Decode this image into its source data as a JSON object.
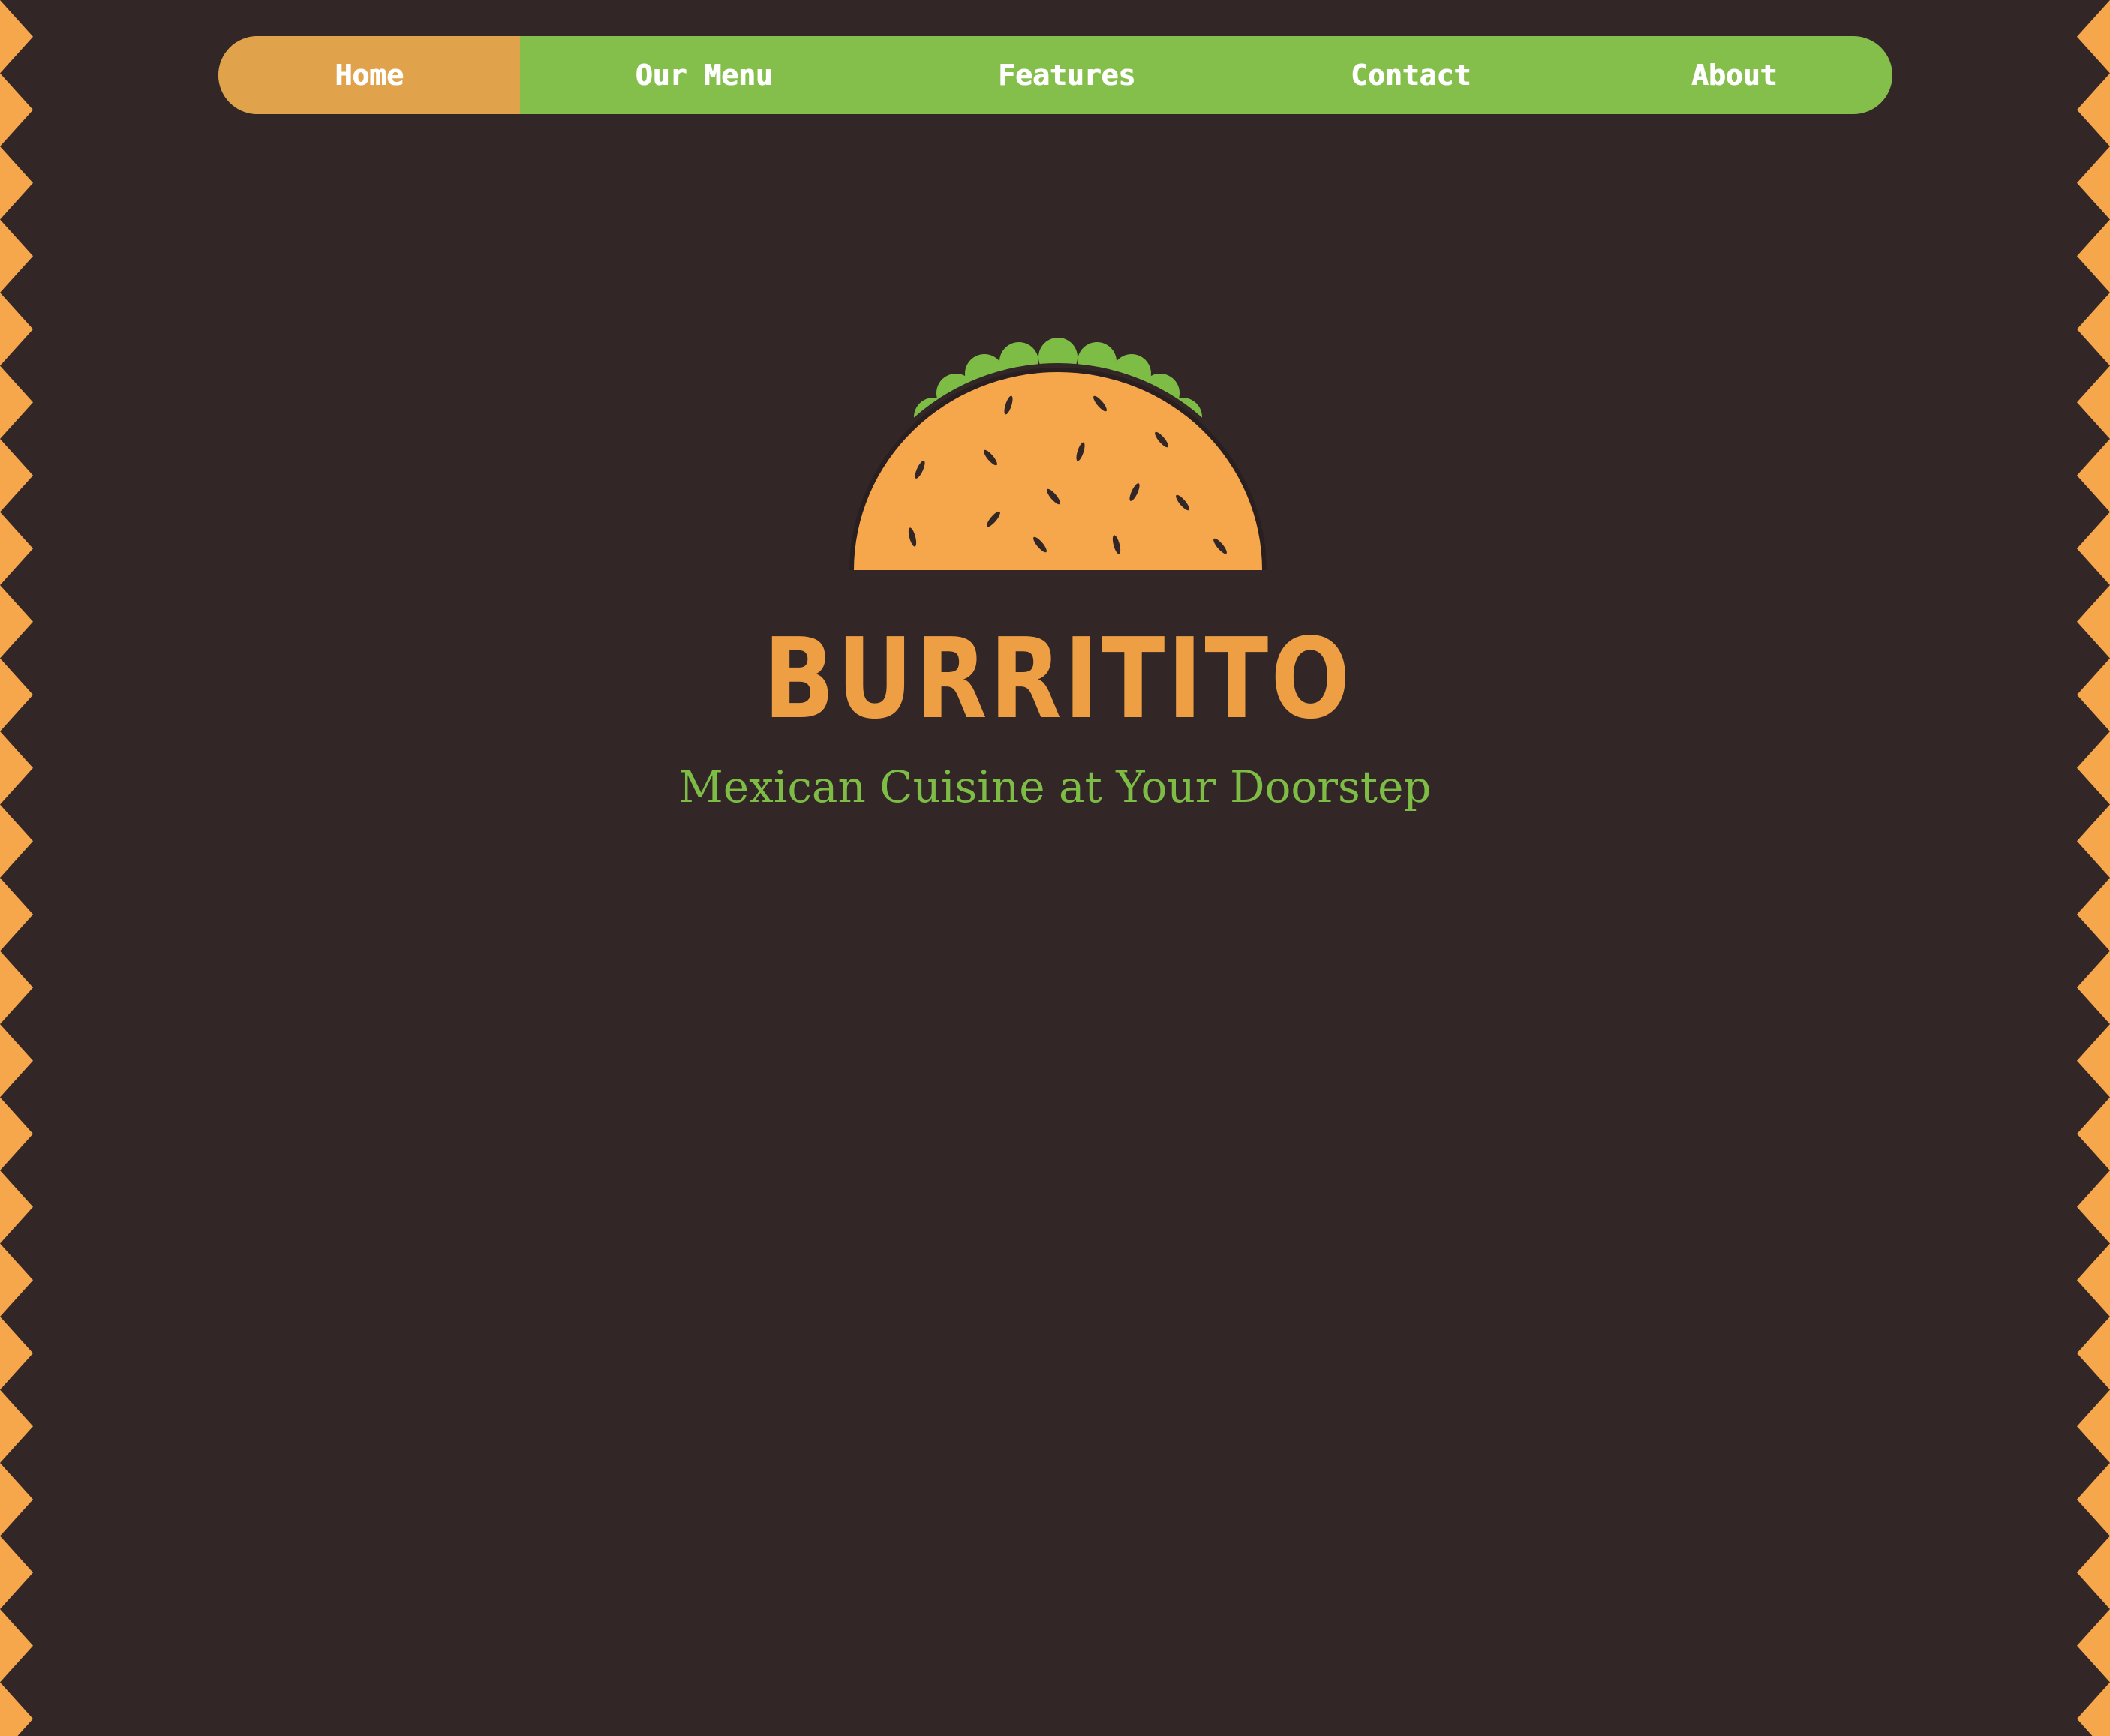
{
  "nav": {
    "items": [
      {
        "label": "Home",
        "active": true
      },
      {
        "label": "Our Menu",
        "active": false
      },
      {
        "label": "Features",
        "active": false
      },
      {
        "label": "Contact",
        "active": false
      },
      {
        "label": "About",
        "active": false
      }
    ]
  },
  "hero": {
    "logo_icon": "taco-icon",
    "title": "BURRITITO",
    "tagline": "Mexican Cuisine at Your Doorstep"
  },
  "colors": {
    "background": "#332627",
    "accent_orange": "#f6a74b",
    "nav_active": "#e0a24b",
    "nav_green": "#84bf4c",
    "tagline_green": "#7dbd45",
    "title_orange": "#ee9f43"
  }
}
